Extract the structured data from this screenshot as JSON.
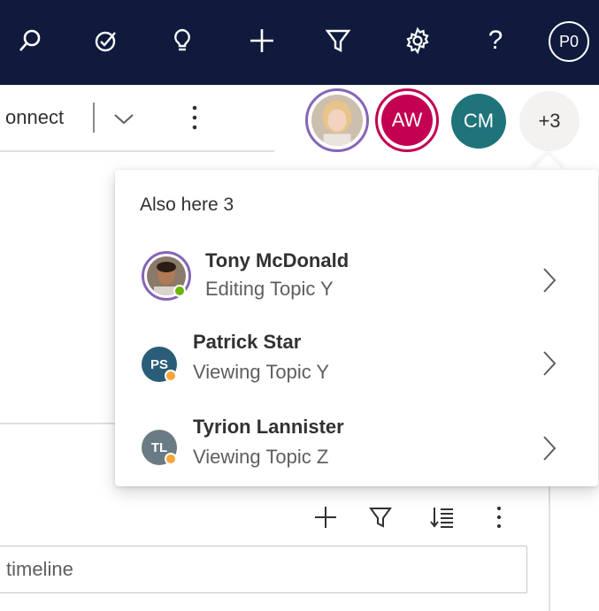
{
  "topbar": {
    "user_initials": "P0",
    "icons": [
      "search-icon",
      "task-icon",
      "lightbulb-icon",
      "plus-icon",
      "filter-icon",
      "settings-icon",
      "help-icon"
    ],
    "help_label": "?",
    "colors": {
      "background": "#0f1a3d"
    }
  },
  "commandbar": {
    "connect_label": "onnect"
  },
  "presence": {
    "aw_initials": "AW",
    "cm_initials": "CM",
    "more_count": "+3",
    "colors": {
      "aw": "#c30052",
      "cm": "#1f7479",
      "photo_ring": "#8764b8"
    }
  },
  "flyout": {
    "title": "Also here 3",
    "people": [
      {
        "name": "Tony McDonald",
        "status": "Editing Topic Y",
        "presence": "available",
        "presence_color": "#6bb700",
        "ring_color": "#8764b8"
      },
      {
        "name": "Patrick Star",
        "initials": "PS",
        "status": "Viewing Topic Y",
        "presence": "away",
        "presence_color": "#f8a53a",
        "avatar_color": "#2a5d78"
      },
      {
        "name": "Tyrion Lannister",
        "initials": "TL",
        "status": "Viewing Topic Z",
        "presence": "away",
        "presence_color": "#f8a53a",
        "avatar_color": "#6b7b83"
      }
    ]
  },
  "timeline": {
    "search_placeholder": "timeline"
  }
}
